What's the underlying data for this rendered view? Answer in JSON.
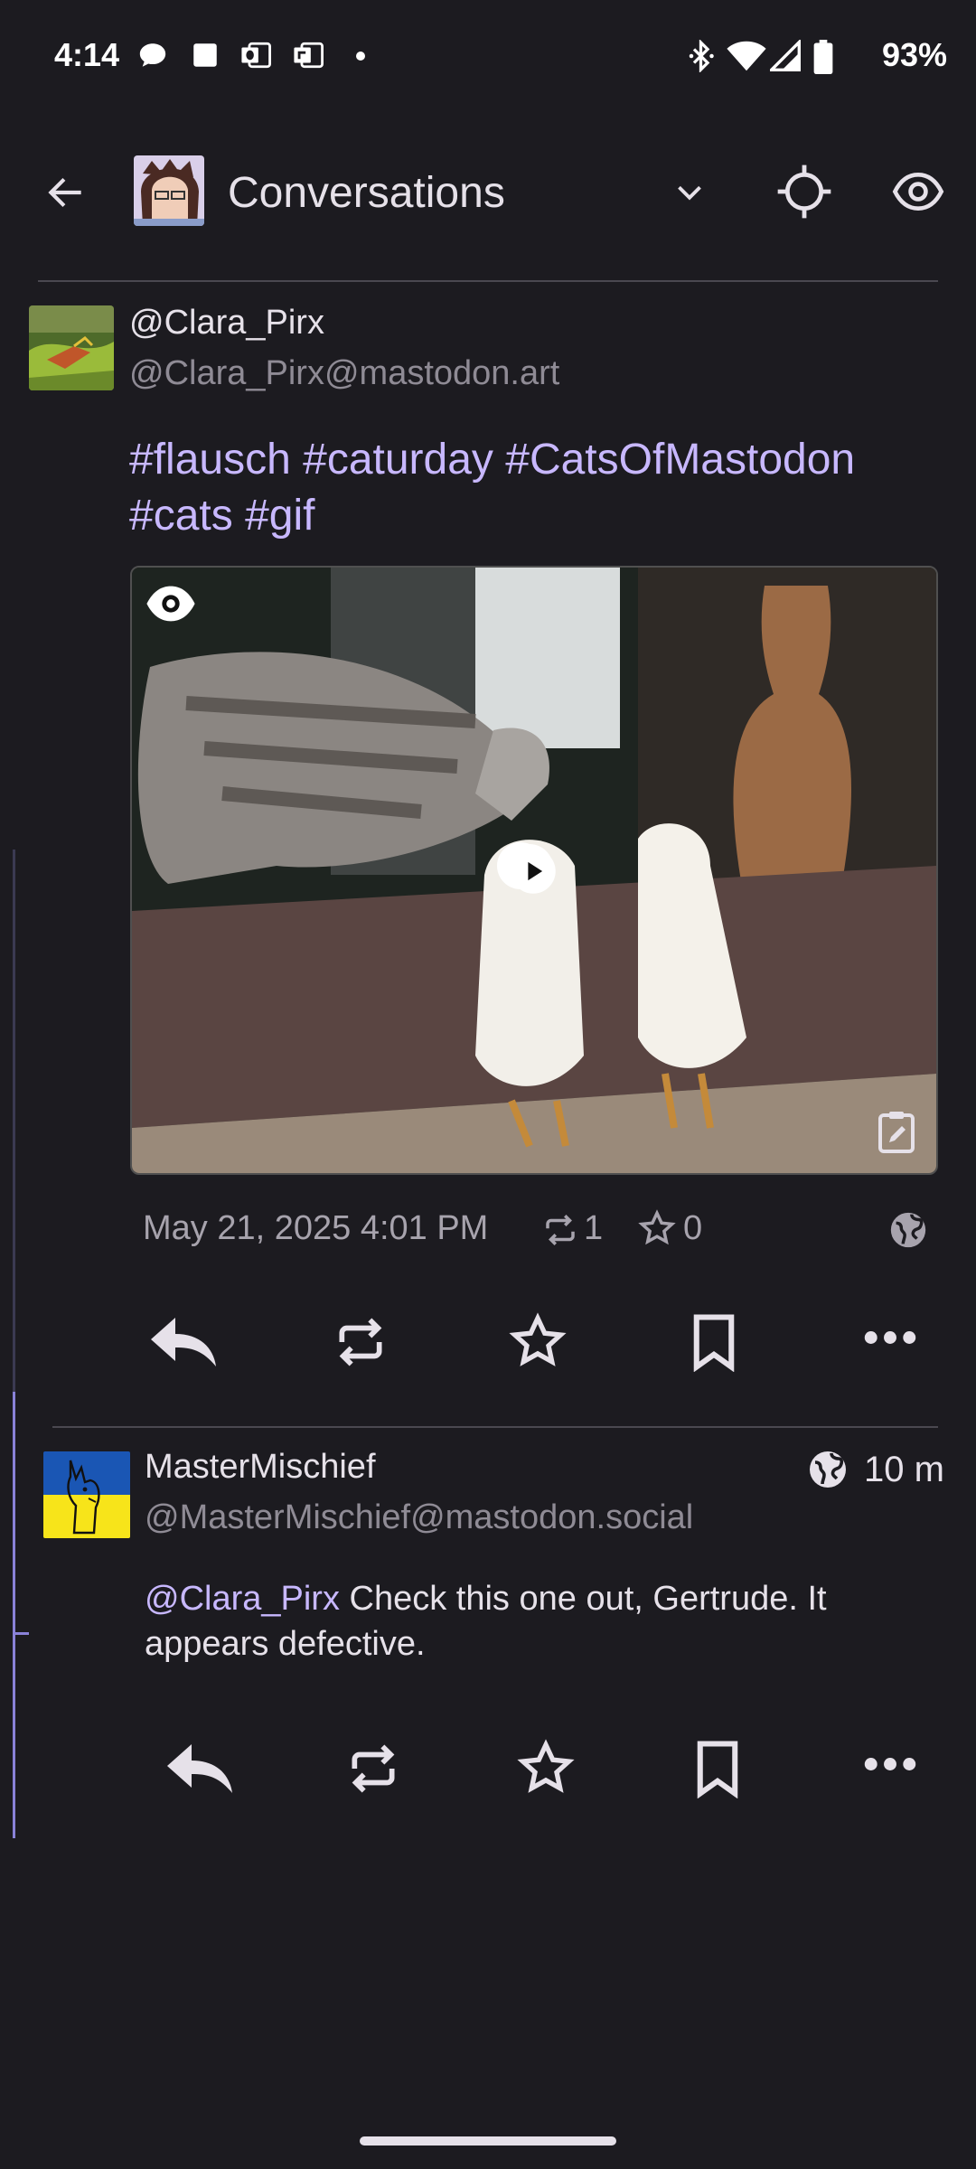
{
  "status_bar": {
    "time": "4:14",
    "battery": "93%",
    "icons": [
      "chat-bubble-icon",
      "square-notification-icon",
      "outlook-icon",
      "office-icon",
      "dot-icon",
      "bluetooth-icon",
      "wifi-icon",
      "signal-icon",
      "battery-icon"
    ]
  },
  "app_bar": {
    "title": "Conversations",
    "icons": [
      "back-arrow-icon",
      "account-avatar",
      "chevron-down-icon",
      "crosshair-icon",
      "eye-icon"
    ]
  },
  "post": {
    "display_name": "@Clara_Pirx",
    "acct": "@Clara_Pirx@mastodon.art",
    "hashtags": "#flausch #caturday #CatsOfMastodon #cats #gif",
    "date": "May 21, 2025 4:01 PM",
    "boosts": "1",
    "favourites": "0"
  },
  "reply": {
    "display_name": "MasterMischief",
    "acct": "@MasterMischief@mastodon.social",
    "time": "10 m",
    "mention": "@Clara_Pirx",
    "text": " Check this one out, Gertrude. It appears defective."
  },
  "colors": {
    "background": "#1c1b20",
    "accent": "#c8b8ff",
    "thread_line": "#8a82d8",
    "muted": "#8f8b95"
  }
}
